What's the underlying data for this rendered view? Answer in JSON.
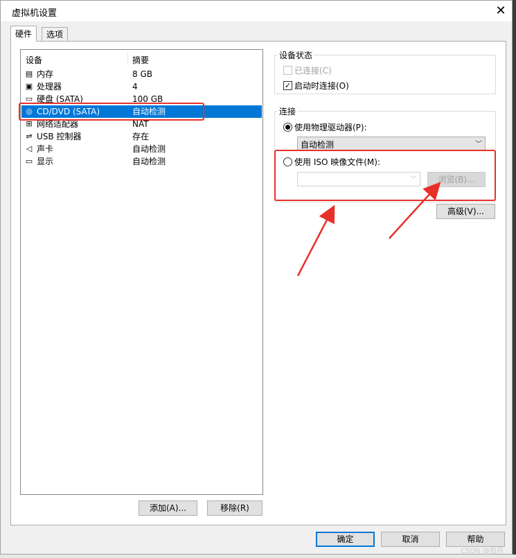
{
  "window": {
    "title": "虚拟机设置",
    "close_glyph": "✕"
  },
  "tabs": [
    {
      "label": "硬件"
    },
    {
      "label": "选项"
    }
  ],
  "device_list": {
    "headers": {
      "device": "设备",
      "summary": "摘要"
    },
    "rows": [
      {
        "icon": "memory-icon",
        "glyph": "▤",
        "name": "内存",
        "value": "8 GB"
      },
      {
        "icon": "processor-icon",
        "glyph": "▣",
        "name": "处理器",
        "value": "4"
      },
      {
        "icon": "hard-disk-icon",
        "glyph": "▭",
        "name": "硬盘 (SATA)",
        "value": "100 GB"
      },
      {
        "icon": "cd-dvd-icon",
        "glyph": "◎",
        "name": "CD/DVD (SATA)",
        "value": "自动检测"
      },
      {
        "icon": "network-adapter-icon",
        "glyph": "⊞",
        "name": "网络适配器",
        "value": "NAT"
      },
      {
        "icon": "usb-controller-icon",
        "glyph": "⇌",
        "name": "USB 控制器",
        "value": "存在"
      },
      {
        "icon": "sound-card-icon",
        "glyph": "◁",
        "name": "声卡",
        "value": "自动检测"
      },
      {
        "icon": "display-icon",
        "glyph": "▭",
        "name": "显示",
        "value": "自动检测"
      }
    ],
    "selected_index": 3
  },
  "list_buttons": {
    "add": "添加(A)...",
    "remove": "移除(R)"
  },
  "device_status": {
    "title": "设备状态",
    "connected": "已连接(C)",
    "connect_at_power_on": "启动时连接(O)",
    "connected_checked": false,
    "power_on_checked": true,
    "check_glyph": "✓"
  },
  "connection": {
    "title": "连接",
    "physical_drive": "使用物理驱动器(P):",
    "physical_drive_value": "自动检测",
    "iso_image": "使用 ISO 映像文件(M):",
    "iso_value": "",
    "browse": "浏览(B)...",
    "selected": "physical",
    "dropdown_glyph": "﹀"
  },
  "advanced_button": "高级(V)...",
  "footer": {
    "ok": "确定",
    "cancel": "取消",
    "help": "帮助"
  },
  "watermark": "CSDN @伯鸟",
  "colors": {
    "selection": "#0078d7",
    "annotation_red": "#e8302a"
  }
}
